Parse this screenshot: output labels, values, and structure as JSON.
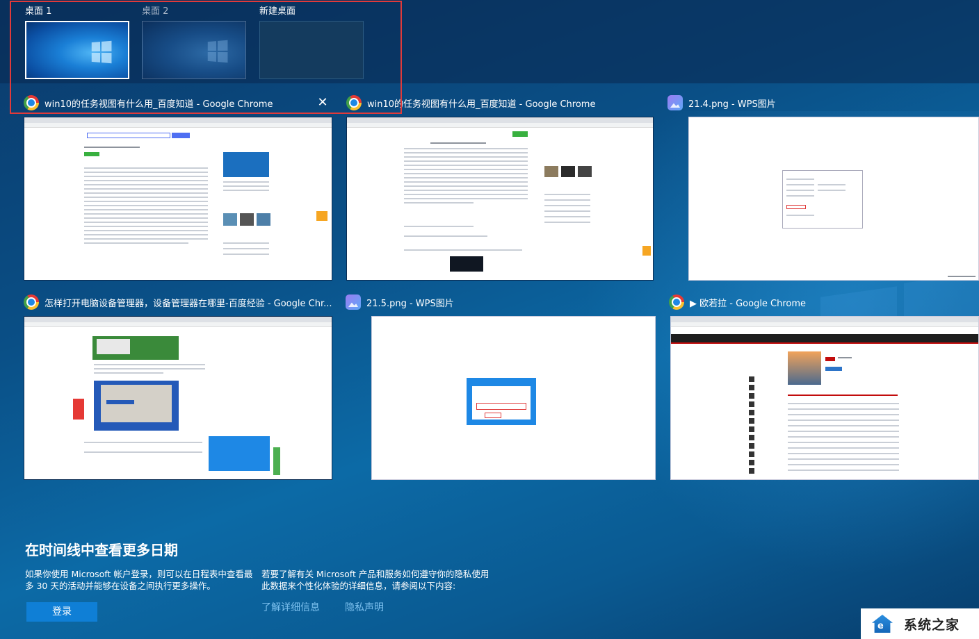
{
  "desktops": [
    {
      "label": "桌面 1",
      "active": true
    },
    {
      "label": "桌面 2",
      "active": false
    },
    {
      "label": "新建桌面",
      "active": false
    }
  ],
  "windows": [
    {
      "title": "win10的任务视图有什么用_百度知道 - Google Chrome",
      "app": "chrome",
      "selected": true,
      "close_icon": "close-icon"
    },
    {
      "title": "win10的任务视图有什么用_百度知道 - Google Chrome",
      "app": "chrome"
    },
    {
      "title": "21.4.png - WPS图片",
      "app": "wps"
    },
    {
      "title": "怎样打开电脑设备管理器，设备管理器在哪里-百度经验 - Google Chr...",
      "app": "chrome"
    },
    {
      "title": "21.5.png - WPS图片",
      "app": "wps"
    },
    {
      "title": "▶ 欧若拉 - Google Chrome",
      "app": "chrome"
    }
  ],
  "timeline": {
    "heading": "在时间线中查看更多日期",
    "left_text_1": "如果你使用 Microsoft 帐户登录，则可以在日程表中查看最",
    "left_text_2": "多 30 天的活动并能够在设备之间执行更多操作。",
    "right_text_1": "若要了解有关 Microsoft 产品和服务如何遵守你的隐私使用",
    "right_text_2": "此数据来个性化体验的详细信息，请参阅以下内容:",
    "login_label": "登录",
    "learn_more": "了解详细信息",
    "privacy": "隐私声明"
  },
  "watermark": {
    "text": "系统之家"
  },
  "colors": {
    "highlight": "#e03a3a",
    "accent": "#0f7fd6",
    "link": "#7cc0ee"
  }
}
